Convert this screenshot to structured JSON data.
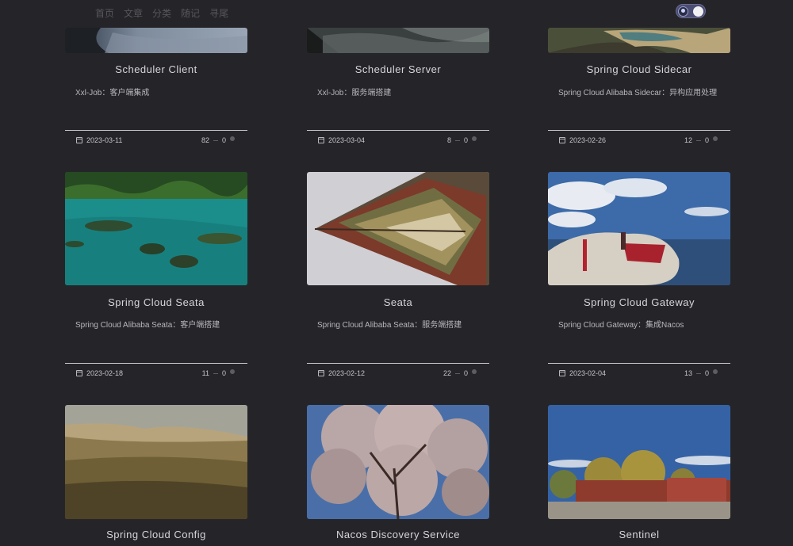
{
  "nav": {
    "items": [
      "首页",
      "文章",
      "分类",
      "随记",
      "寻尾"
    ]
  },
  "theme_toggle": {
    "state": "dark"
  },
  "colors": {
    "background": "#252529",
    "divider": "#c8c8cc",
    "accent_toggle": "#4b4d73"
  },
  "cards": [
    {
      "title": "Scheduler Client",
      "desc": "Xxl-Job：客户端集成",
      "date": "2023-03-11",
      "views": "82",
      "comments": "0"
    },
    {
      "title": "Scheduler Server",
      "desc": "Xxl-Job：服务端搭建",
      "date": "2023-03-04",
      "views": "8",
      "comments": "0"
    },
    {
      "title": "Spring Cloud Sidecar",
      "desc": "Spring Cloud Alibaba Sidecar：异构应用处理",
      "date": "2023-02-26",
      "views": "12",
      "comments": "0"
    },
    {
      "title": "Spring Cloud Seata",
      "desc": "Spring Cloud Alibaba Seata：客户端搭建",
      "date": "2023-02-18",
      "views": "11",
      "comments": "0"
    },
    {
      "title": "Seata",
      "desc": "Spring Cloud Alibaba Seata：服务端搭建",
      "date": "2023-02-12",
      "views": "22",
      "comments": "0"
    },
    {
      "title": "Spring Cloud Gateway",
      "desc": "Spring Cloud Gateway：集成Nacos",
      "date": "2023-02-04",
      "views": "13",
      "comments": "0"
    },
    {
      "title": "Spring Cloud Config",
      "desc": "",
      "date": "",
      "views": "",
      "comments": ""
    },
    {
      "title": "Nacos Discovery Service",
      "desc": "",
      "date": "",
      "views": "",
      "comments": ""
    },
    {
      "title": "Sentinel",
      "desc": "",
      "date": "",
      "views": "",
      "comments": ""
    }
  ]
}
